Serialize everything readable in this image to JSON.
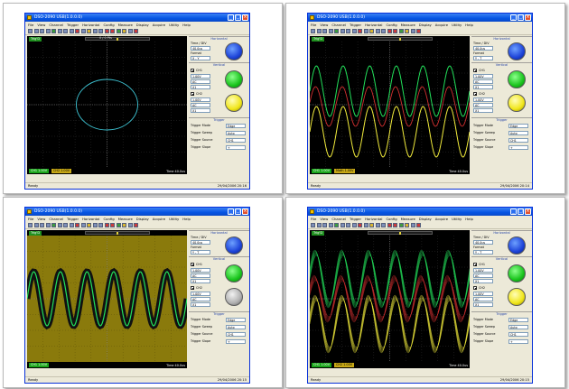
{
  "windows": [
    {
      "title": "DSO-2090 USB(1.0.0.0)",
      "mode": "xy",
      "menu": [
        "File",
        "View",
        "Channel",
        "Trigger",
        "Horizontal",
        "Config",
        "Measure",
        "Display",
        "Acquire",
        "Utility",
        "Help"
      ],
      "run_label": "Trig'D",
      "position_text": "0 / 0 Pts",
      "ch_bar": {
        "ch1": "CH1  1.00V",
        "ch2": "CH2  1.00V",
        "timebase": "Time  40.0us"
      },
      "status_left": "Ready",
      "status_right": "29/04/2006  20:16",
      "panel": {
        "horizontal_title": "Horizontal",
        "time_label": "Time / DIV",
        "time_value": "40.0us",
        "format_label": "Format",
        "format_value": "X - Y",
        "vertical_title": "Vertical",
        "ch1_label": "CH1",
        "ch1_volts": "1.00V",
        "ch1_coupling": "AC",
        "ch1_probe": "X1",
        "ch2_label": "CH2",
        "ch2_volts": "1.00V",
        "ch2_coupling": "AC",
        "ch2_probe": "X1",
        "trigger_title": "Trigger",
        "trigger_rows": [
          {
            "label": "Trigger Mode",
            "value": "Edge"
          },
          {
            "label": "Trigger Sweep",
            "value": "Auto"
          },
          {
            "label": "Trigger Source",
            "value": "CH1"
          },
          {
            "label": "Trigger Slope",
            "value": "+"
          }
        ]
      }
    },
    {
      "title": "DSO-2090 USB(1.0.0.0)",
      "mode": "yt-three",
      "menu": [
        "File",
        "View",
        "Channel",
        "Trigger",
        "Horizontal",
        "Config",
        "Measure",
        "Display",
        "Acquire",
        "Utility",
        "Help"
      ],
      "run_label": "Trig'D",
      "position_text": "",
      "ch_bar": {
        "ch1": "CH1  1.00V",
        "ch2": "Math  1.00V",
        "timebase": "Time  40.0us"
      },
      "status_left": "Ready",
      "status_right": "29/04/2006  20:14",
      "panel": {
        "horizontal_title": "Horizontal",
        "time_label": "Time / DIV",
        "time_value": "40.0us",
        "format_label": "Format",
        "format_value": "Y - T",
        "vertical_title": "Vertical",
        "ch1_label": "CH1",
        "ch1_volts": "1.00V",
        "ch1_coupling": "AC",
        "ch1_probe": "X1",
        "ch2_label": "CH2",
        "ch2_volts": "1.00V",
        "ch2_coupling": "AC",
        "ch2_probe": "X1",
        "trigger_title": "Trigger",
        "trigger_rows": [
          {
            "label": "Trigger Mode",
            "value": "Edge"
          },
          {
            "label": "Trigger Sweep",
            "value": "Auto"
          },
          {
            "label": "Trigger Source",
            "value": "CH1"
          },
          {
            "label": "Trigger Slope",
            "value": "+"
          }
        ]
      }
    },
    {
      "title": "DSO-2090 USB(1.0.0.0)",
      "mode": "yt-olive",
      "menu": [
        "File",
        "View",
        "Channel",
        "Trigger",
        "Horizontal",
        "Config",
        "Measure",
        "Display",
        "Acquire",
        "Utility",
        "Help"
      ],
      "run_label": "Trig'D",
      "position_text": "",
      "ch_bar": {
        "ch1": "CH1  1.00V",
        "ch2": "",
        "timebase": "Time  40.0us"
      },
      "status_left": "Ready",
      "status_right": "29/04/2006  20:15",
      "panel": {
        "horizontal_title": "Horizontal",
        "time_label": "Time / DIV",
        "time_value": "40.0us",
        "format_label": "Format",
        "format_value": "Y - T",
        "vertical_title": "Vertical",
        "ch1_label": "CH1",
        "ch1_volts": "1.00V",
        "ch1_coupling": "AC",
        "ch1_probe": "X1",
        "ch2_label": "CH2",
        "ch2_volts": "1.00V",
        "ch2_coupling": "AC",
        "ch2_probe": "X1",
        "trigger_title": "Trigger",
        "trigger_rows": [
          {
            "label": "Trigger Mode",
            "value": "Edge"
          },
          {
            "label": "Trigger Sweep",
            "value": "Auto"
          },
          {
            "label": "Trigger Source",
            "value": "CH1"
          },
          {
            "label": "Trigger Slope",
            "value": "+"
          }
        ]
      }
    },
    {
      "title": "DSO-2090 USB(1.0.0.0)",
      "mode": "yt-persist",
      "menu": [
        "File",
        "View",
        "Channel",
        "Trigger",
        "Horizontal",
        "Config",
        "Measure",
        "Display",
        "Acquire",
        "Utility",
        "Help"
      ],
      "run_label": "Trig'D",
      "position_text": "",
      "ch_bar": {
        "ch1": "CH1  1.00V",
        "ch2": "CH2  1.00V",
        "timebase": "Time  40.0us"
      },
      "status_left": "Ready",
      "status_right": "29/04/2006  20:15",
      "panel": {
        "horizontal_title": "Horizontal",
        "time_label": "Time / DIV",
        "time_value": "40.0us",
        "format_label": "Format",
        "format_value": "Y - T",
        "vertical_title": "Vertical",
        "ch1_label": "CH1",
        "ch1_volts": "1.00V",
        "ch1_coupling": "AC",
        "ch1_probe": "X1",
        "ch2_label": "CH2",
        "ch2_volts": "1.00V",
        "ch2_coupling": "AC",
        "ch2_probe": "X1",
        "trigger_title": "Trigger",
        "trigger_rows": [
          {
            "label": "Trigger Mode",
            "value": "Edge"
          },
          {
            "label": "Trigger Sweep",
            "value": "Auto"
          },
          {
            "label": "Trigger Source",
            "value": "CH1"
          },
          {
            "label": "Trigger Slope",
            "value": "+"
          }
        ]
      }
    }
  ],
  "colors": {
    "screen_bg": "#000000",
    "olive_bg": "#8a7a0c",
    "ch1": "#22e05a",
    "ch2": "#f2ec3c",
    "math": "#d23030",
    "xy_trace": "#3fc8d8",
    "grid": "#3a3a3a"
  },
  "icons": [
    "app-icon",
    "minimize-icon",
    "maximize-icon",
    "close-icon",
    "time-div-knob",
    "ch1-knob",
    "ch2-knob"
  ]
}
